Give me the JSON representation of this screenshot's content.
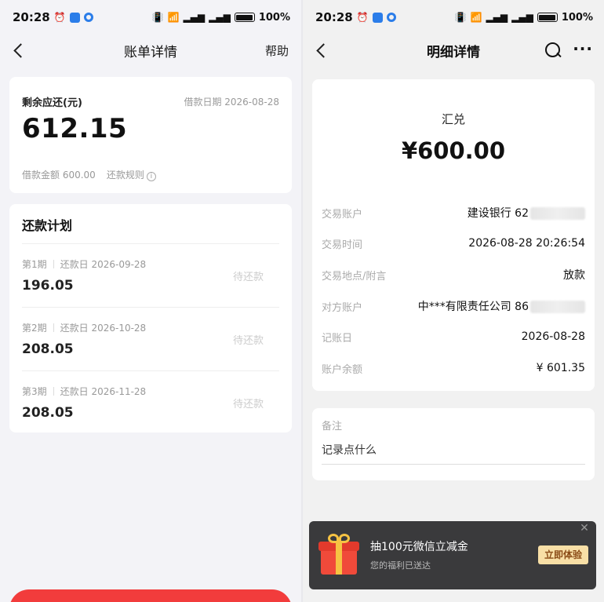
{
  "left": {
    "status": {
      "time": "20:28",
      "battery": "100%"
    },
    "nav": {
      "title": "账单详情",
      "help": "帮助"
    },
    "summary": {
      "remain_label": "剩余应还(元)",
      "loan_date": "借款日期 2026-08-28",
      "remain_amount": "612.15",
      "loan_amount": "借款金额 600.00",
      "repay_rule": "还款规则"
    },
    "plan": {
      "title": "还款计划",
      "rows": [
        {
          "period": "第1期",
          "date": "还款日 2026-09-28",
          "amount": "196.05",
          "status": "待还款"
        },
        {
          "period": "第2期",
          "date": "还款日 2026-10-28",
          "amount": "208.05",
          "status": "待还款"
        },
        {
          "period": "第3期",
          "date": "还款日 2026-11-28",
          "amount": "208.05",
          "status": "待还款"
        }
      ]
    },
    "accent": "#f23c3c"
  },
  "right": {
    "status": {
      "time": "20:28",
      "battery": "100%"
    },
    "nav": {
      "title": "明细详情"
    },
    "detail": {
      "type": "汇兑",
      "amount": "¥600.00",
      "rows": [
        {
          "key": "交易账户",
          "value": "建设银行 62"
        },
        {
          "key": "交易时间",
          "value": "2026-08-28 20:26:54"
        },
        {
          "key": "交易地点/附言",
          "value": "放款"
        },
        {
          "key": "对方账户",
          "value": "中***有限责任公司 86"
        },
        {
          "key": "记账日",
          "value": "2026-08-28"
        },
        {
          "key": "账户余额",
          "value": "¥ 601.35"
        }
      ]
    },
    "memo": {
      "label": "备注",
      "placeholder": "记录点什么"
    },
    "promo": {
      "title": "抽100元微信立减金",
      "subtitle": "您的福利已送达",
      "button": "立即体验",
      "close": "✕"
    }
  }
}
